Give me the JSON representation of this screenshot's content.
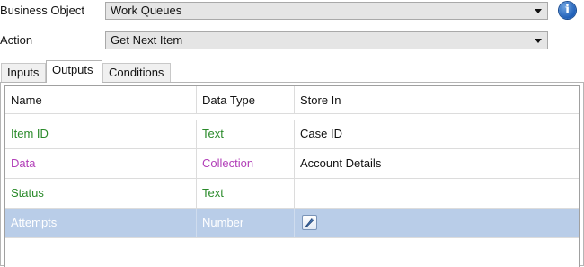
{
  "form": {
    "business_object": {
      "label": "Business Object",
      "value": "Work Queues"
    },
    "action": {
      "label": "Action",
      "value": "Get Next Item"
    }
  },
  "tabs": [
    {
      "label": "Inputs",
      "active": false
    },
    {
      "label": "Outputs",
      "active": true
    },
    {
      "label": "Conditions",
      "active": false
    }
  ],
  "grid": {
    "columns": [
      "Name",
      "Data Type",
      "Store In"
    ],
    "rows": [
      {
        "name": "Item ID",
        "data_type": "Text",
        "store_in": "Case ID",
        "color": "#2a8a2a"
      },
      {
        "name": "Data",
        "data_type": "Collection",
        "store_in": "Account Details",
        "color": "#b23fb8"
      },
      {
        "name": "Status",
        "data_type": "Text",
        "store_in": "",
        "color": "#2a8a2a"
      },
      {
        "name": "Attempts",
        "data_type": "Number",
        "store_in": "",
        "color": "#ffffff",
        "selected": true
      }
    ]
  },
  "colors": {
    "selection": "#b9cde8",
    "text_type": "#2a8a2a",
    "collection_type": "#b23fb8",
    "info_icon": "#1f5fb8"
  }
}
